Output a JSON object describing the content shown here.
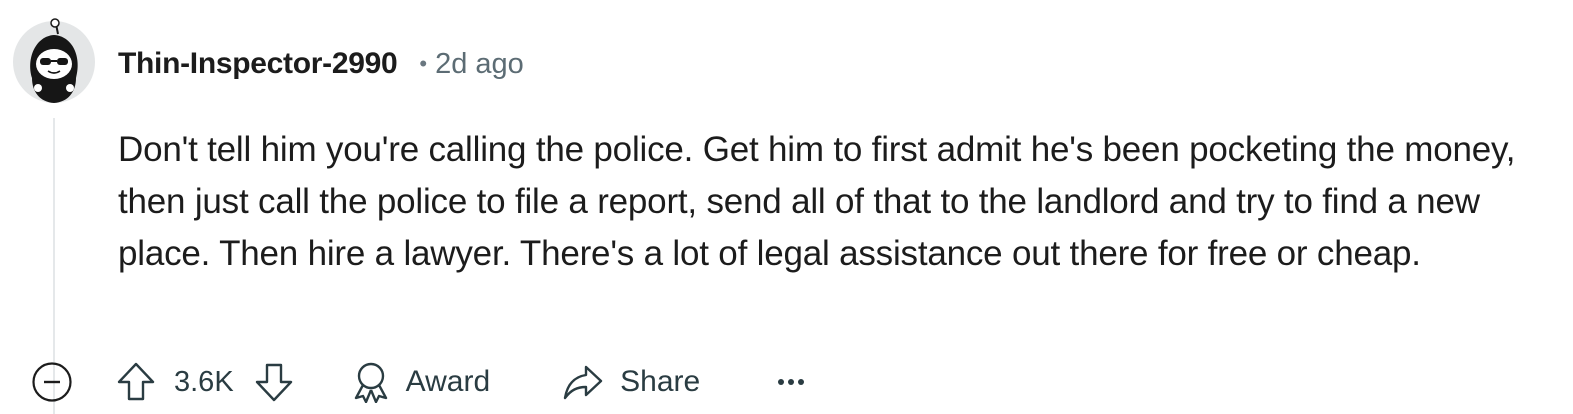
{
  "comment": {
    "author": "Thin-Inspector-2990",
    "separator": "•",
    "timestamp": "2d ago",
    "body": "Don't tell him you're calling the police. Get him to first admit he's been pocketing the money, then just call the police to file a report, send all of that to the landlord and try to find a new place. Then hire a lawyer. There's a lot of legal assistance out there for free or cheap."
  },
  "actions": {
    "score": "3.6K",
    "award_label": "Award",
    "share_label": "Share"
  },
  "icons": {
    "avatar": "snoo-avatar-hooded-sunglasses",
    "collapse": "minus-circle-icon",
    "upvote": "arrow-up-icon",
    "downvote": "arrow-down-icon",
    "award": "award-ribbon-icon",
    "share": "share-arrow-icon",
    "more": "ellipsis-icon"
  },
  "colors": {
    "text": "#1c1c1c",
    "muted": "#5c6c74",
    "action": "#2a3c42",
    "thread_line": "#e5e8ea"
  }
}
